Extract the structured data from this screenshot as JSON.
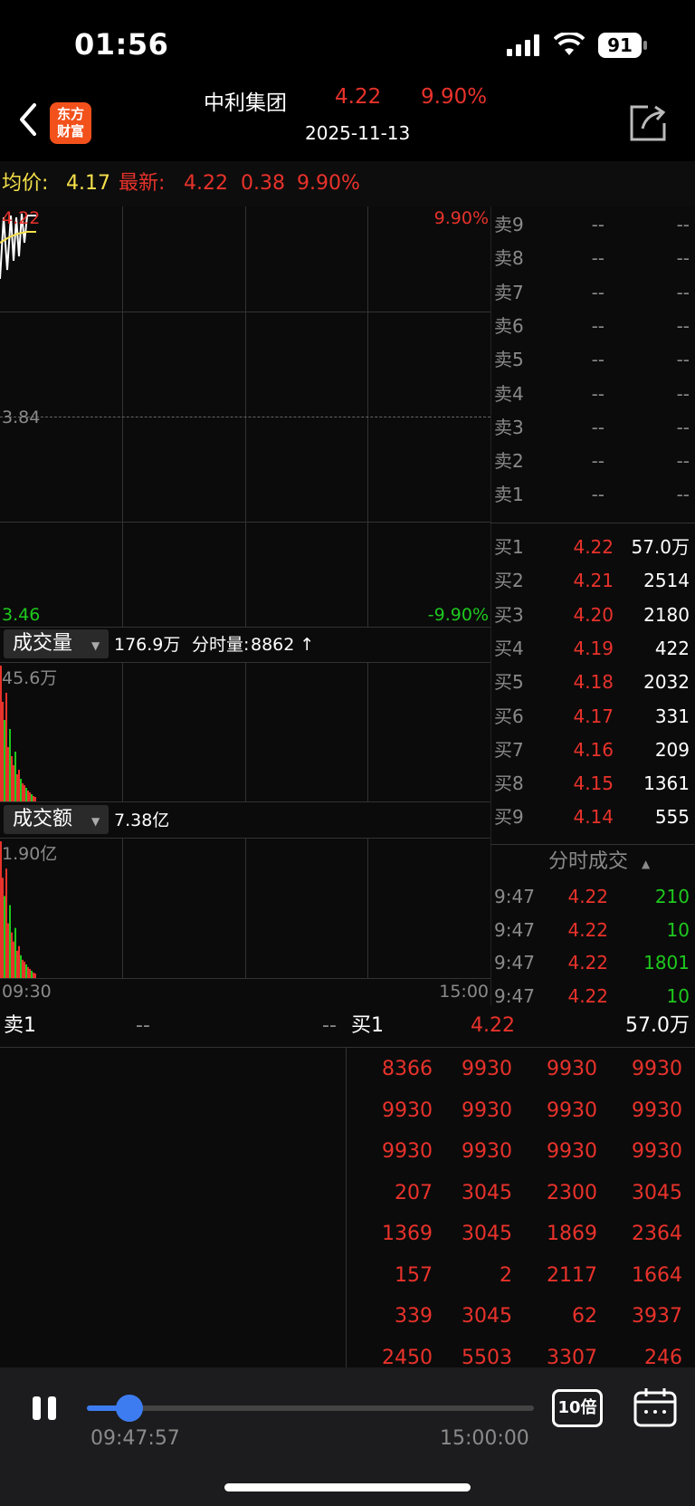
{
  "status": {
    "time": "01:56",
    "battery": "91"
  },
  "header": {
    "name": "中利集团",
    "price": "4.22",
    "pct": "9.90%",
    "date": "2025-11-13",
    "logo_line1": "东方",
    "logo_line2": "财富"
  },
  "info": {
    "avg_label": "均价:",
    "avg": "4.17",
    "latest_label": "最新:",
    "latest": "4.22",
    "change": "0.38",
    "pct": "9.90%"
  },
  "chart": {
    "high": "4.22",
    "high_pct": "9.90%",
    "mid": "3.84",
    "low": "3.46",
    "low_pct": "-9.90%",
    "vol_label": "成交量",
    "vol_total": "176.9万",
    "vol_tick_label": "分时量:",
    "vol_tick": "8862 ↑",
    "vol_max": "45.6万",
    "amt_label": "成交额",
    "amt_total": "7.38亿",
    "amt_max": "1.90亿",
    "time_start": "09:30",
    "time_end": "15:00"
  },
  "orderbook": {
    "asks": [
      {
        "label": "卖9",
        "price": "--",
        "vol": "--"
      },
      {
        "label": "卖8",
        "price": "--",
        "vol": "--"
      },
      {
        "label": "卖7",
        "price": "--",
        "vol": "--"
      },
      {
        "label": "卖6",
        "price": "--",
        "vol": "--"
      },
      {
        "label": "卖5",
        "price": "--",
        "vol": "--"
      },
      {
        "label": "卖4",
        "price": "--",
        "vol": "--"
      },
      {
        "label": "卖3",
        "price": "--",
        "vol": "--"
      },
      {
        "label": "卖2",
        "price": "--",
        "vol": "--"
      },
      {
        "label": "卖1",
        "price": "--",
        "vol": "--"
      }
    ],
    "bids": [
      {
        "label": "买1",
        "price": "4.22",
        "vol": "57.0万"
      },
      {
        "label": "买2",
        "price": "4.21",
        "vol": "2514"
      },
      {
        "label": "买3",
        "price": "4.20",
        "vol": "2180"
      },
      {
        "label": "买4",
        "price": "4.19",
        "vol": "422"
      },
      {
        "label": "买5",
        "price": "4.18",
        "vol": "2032"
      },
      {
        "label": "买6",
        "price": "4.17",
        "vol": "331"
      },
      {
        "label": "买7",
        "price": "4.16",
        "vol": "209"
      },
      {
        "label": "买8",
        "price": "4.15",
        "vol": "1361"
      },
      {
        "label": "买9",
        "price": "4.14",
        "vol": "555"
      }
    ]
  },
  "ticks": {
    "title": "分时成交",
    "rows": [
      {
        "time": "9:47",
        "price": "4.22",
        "vol": "210"
      },
      {
        "time": "9:47",
        "price": "4.22",
        "vol": "10"
      },
      {
        "time": "9:47",
        "price": "4.22",
        "vol": "1801"
      },
      {
        "time": "9:47",
        "price": "4.22",
        "vol": "10"
      }
    ]
  },
  "queue": {
    "ask_label": "卖1",
    "ask_price": "--",
    "ask_vol": "--",
    "bid_label": "买1",
    "bid_price": "4.22",
    "bid_vol": "57.0万",
    "rows": [
      [
        "8366",
        "9930",
        "9930",
        "9930"
      ],
      [
        "9930",
        "9930",
        "9930",
        "9930"
      ],
      [
        "9930",
        "9930",
        "9930",
        "9930"
      ],
      [
        "207",
        "3045",
        "2300",
        "3045"
      ],
      [
        "1369",
        "3045",
        "1869",
        "2364"
      ],
      [
        "157",
        "2",
        "2117",
        "1664"
      ],
      [
        "339",
        "3045",
        "62",
        "3937"
      ],
      [
        "2450",
        "5503",
        "3307",
        "246"
      ]
    ]
  },
  "player": {
    "current_time": "09:47:57",
    "end_time": "15:00:00",
    "speed": "10倍",
    "progress": 0.095
  },
  "colors": {
    "up": "#e8322b",
    "down": "#1ec91e",
    "avg": "#f5e04a",
    "brand": "#f2511b"
  }
}
